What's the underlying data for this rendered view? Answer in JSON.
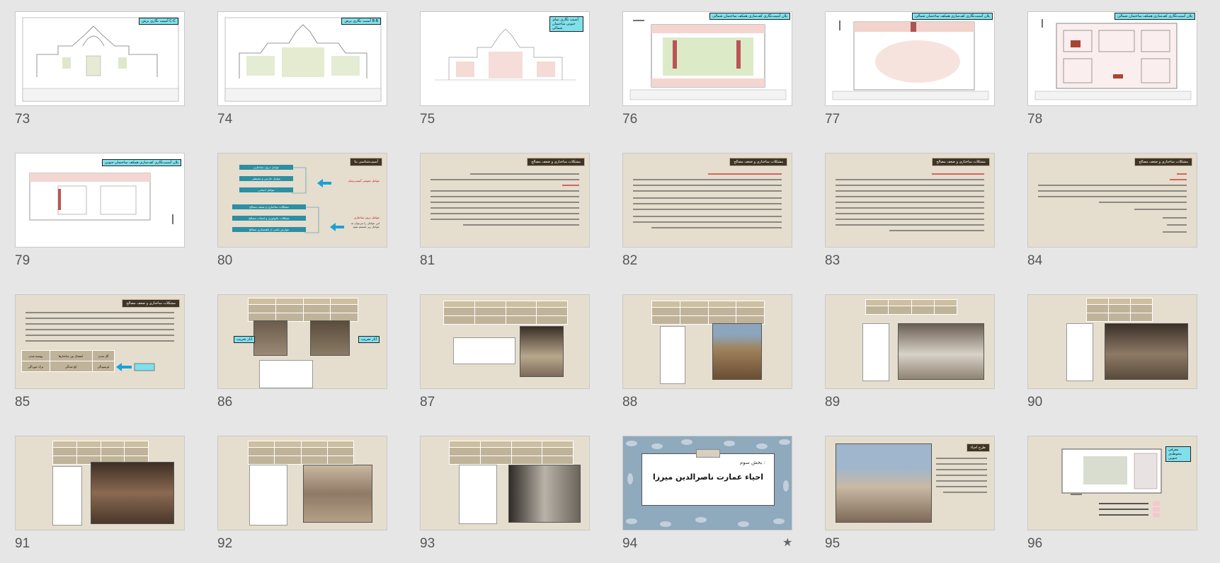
{
  "view": "slide-sorter",
  "slides": [
    {
      "number": "73",
      "kind": "drawing",
      "tag": "آسیب نگاری برش C-C"
    },
    {
      "number": "74",
      "kind": "drawing",
      "tag": "آسیب نگاری برش B-B"
    },
    {
      "number": "75",
      "kind": "drawing",
      "tag": "آسیب نگاری نمای جنوبی ساختمان شمالی"
    },
    {
      "number": "76",
      "kind": "plan",
      "tag": "پلان آسیب‌نگاری کف‌سازی همکف ساختمان شمالی"
    },
    {
      "number": "77",
      "kind": "plan",
      "tag": "پلان آسیب‌نگاری کف‌سازی همکف ساختمان شمالی"
    },
    {
      "number": "78",
      "kind": "plan",
      "tag": "پلان آسیب‌نگاری کف‌سازی همکف ساختمان شمالی"
    },
    {
      "number": "79",
      "kind": "drawing",
      "tag": "پلان آسیب‌نگاری کف‌سازی همکف ساختمان جنوبی"
    },
    {
      "number": "80",
      "kind": "diagram",
      "title": "آسیب‌شناسی بنا",
      "left_labels": [
        "عوامل عمومی آسیب‌رسان",
        "عوامل درون ساختاری"
      ],
      "note": "این عوامل را می‌توان به عوامل زیر تقسیم نمود",
      "boxes": [
        "عوامل درون ساختاری",
        "عوامل خارجی و محیطی",
        "عوامل انسانی",
        "مشکلات ساختاری و ضعف مصالح",
        "مشکلات تکنولوژی و انتخاب مصالح",
        "عوارض ناشی از ناهمسازی مصالح"
      ]
    },
    {
      "number": "81",
      "kind": "text",
      "title": "مشکلات ساختاری و ضعف مصالح"
    },
    {
      "number": "82",
      "kind": "text",
      "title": "مشکلات ساختاری و ضعف مصالح"
    },
    {
      "number": "83",
      "kind": "text",
      "title": "مشکلات ساختاری و ضعف مصالح"
    },
    {
      "number": "84",
      "kind": "text",
      "title": "مشکلات ساختاری و ضعف مصالح"
    },
    {
      "number": "85",
      "kind": "text-grid",
      "title": "مشکلات ساختاری و ضعف مصالح",
      "grid": [
        "پوسته شدن",
        "گل شدن",
        "انفصال بین ساختارها",
        "ترک خوردگی",
        "کج شدگی",
        "فرسودگی"
      ]
    },
    {
      "number": "86",
      "kind": "photos",
      "tag_left": "آثار تخریب",
      "tag_right": "آثار تخریب"
    },
    {
      "number": "87",
      "kind": "photos"
    },
    {
      "number": "88",
      "kind": "photos"
    },
    {
      "number": "89",
      "kind": "photos"
    },
    {
      "number": "90",
      "kind": "photos"
    },
    {
      "number": "91",
      "kind": "photos"
    },
    {
      "number": "92",
      "kind": "photos"
    },
    {
      "number": "93",
      "kind": "photos"
    },
    {
      "number": "94",
      "kind": "section",
      "subtitle": "بخش سوم :",
      "main": "احیاء عمارت ناصرالدین میرزا",
      "has_star": true
    },
    {
      "number": "95",
      "kind": "photo-text",
      "title": "طرح احیاء"
    },
    {
      "number": "96",
      "kind": "plan-legend",
      "tag": "معرفی محوطه‌ی جنوبی"
    }
  ],
  "colors": {
    "app_bg": "#e6e6e6",
    "slide_beige": "#e5ddce",
    "tag_cyan": "#7fe0ec",
    "title_brown": "#3f3526",
    "diagram_teal": "#2d8fa2",
    "number_gray": "#555555"
  },
  "icons": {
    "transition_marker": "star-icon"
  }
}
